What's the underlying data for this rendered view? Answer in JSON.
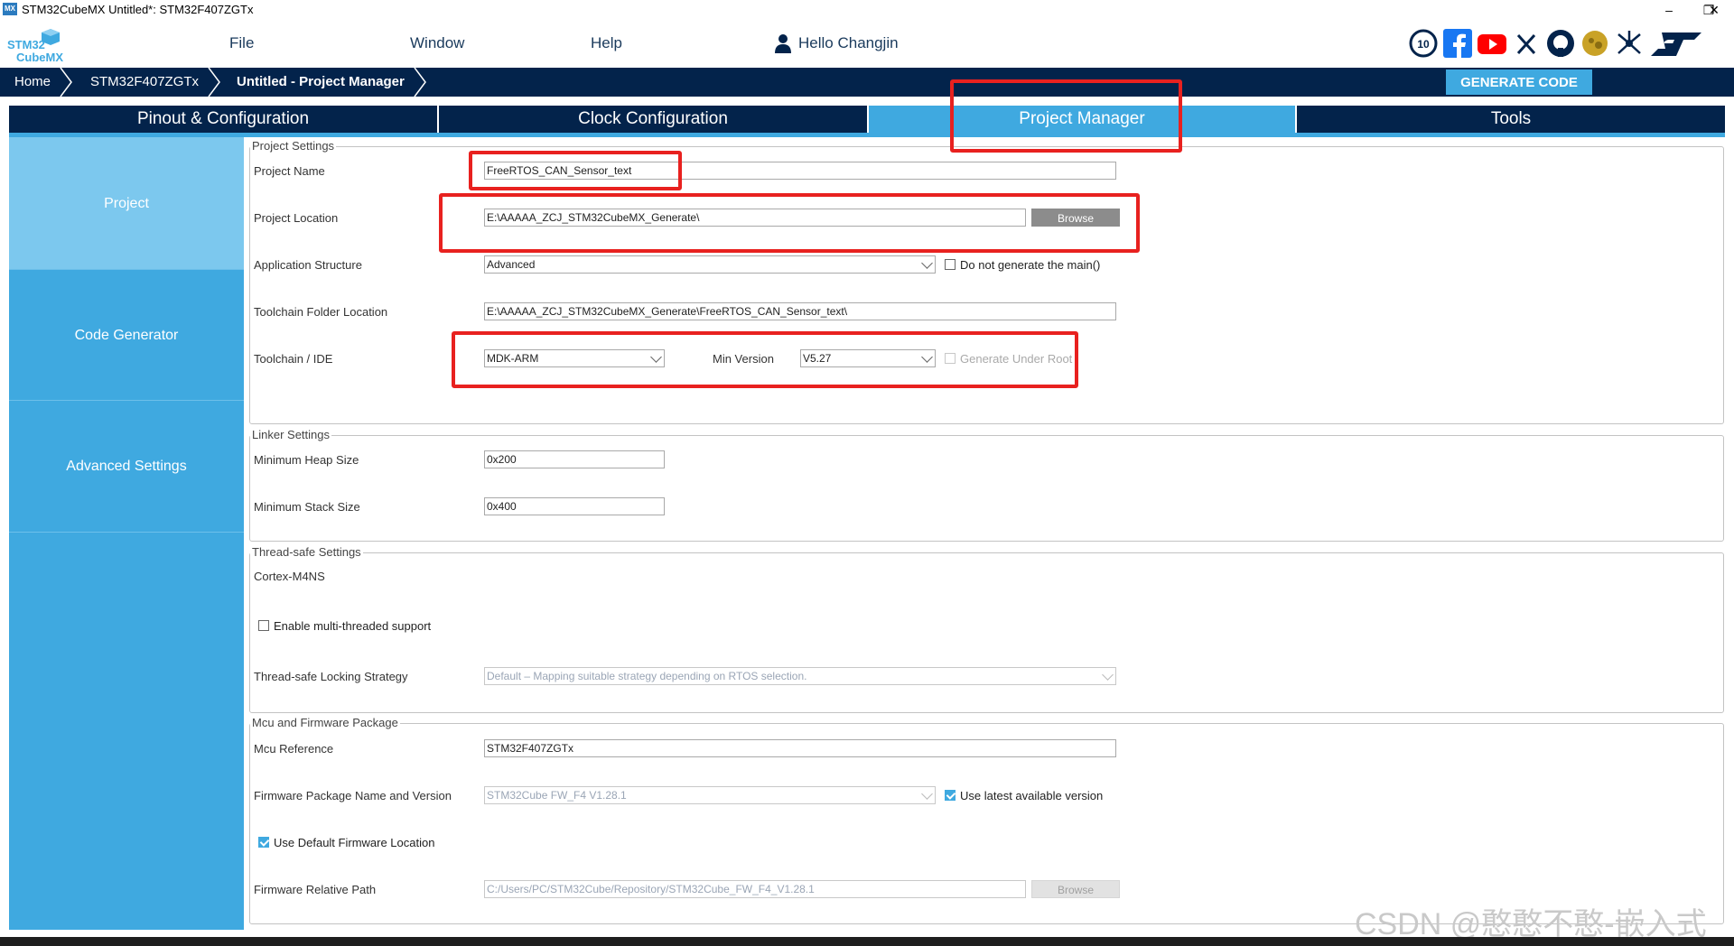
{
  "window": {
    "app_icon_text": "MX",
    "title": "STM32CubeMX Untitled*: STM32F407ZGTx",
    "controls": [
      "–",
      "❐",
      "✕"
    ]
  },
  "logo": {
    "line1": "STM32",
    "line2": "CubeMX"
  },
  "menu": {
    "items": [
      "File",
      "Window",
      "Help"
    ],
    "user_greeting": "Hello Changjin"
  },
  "social_icons": [
    "anniversary-icon",
    "facebook-icon",
    "youtube-icon",
    "x-icon",
    "github-icon",
    "community-icon",
    "network-icon",
    "st-logo-icon"
  ],
  "breadcrumb": [
    "Home",
    "STM32F407ZGTx",
    "Untitled - Project Manager"
  ],
  "generate_button": "GENERATE CODE",
  "tabs": [
    {
      "label": "Pinout & Configuration",
      "active": false
    },
    {
      "label": "Clock Configuration",
      "active": false
    },
    {
      "label": "Project Manager",
      "active": true
    },
    {
      "label": "Tools",
      "active": false
    }
  ],
  "sidebar": [
    {
      "label": "Project",
      "active": true
    },
    {
      "label": "Code Generator",
      "active": false
    },
    {
      "label": "Advanced Settings",
      "active": false
    }
  ],
  "project_settings": {
    "title": "Project Settings",
    "project_name_label": "Project Name",
    "project_name": "FreeRTOS_CAN_Sensor_text",
    "project_location_label": "Project Location",
    "project_location": "E:\\AAAAA_ZCJ_STM32CubeMX_Generate\\",
    "browse": "Browse",
    "app_structure_label": "Application Structure",
    "app_structure": "Advanced",
    "no_main_label": "Do not generate the main()",
    "no_main_checked": false,
    "toolchain_folder_label": "Toolchain Folder Location",
    "toolchain_folder": "E:\\AAAAA_ZCJ_STM32CubeMX_Generate\\FreeRTOS_CAN_Sensor_text\\",
    "toolchain_ide_label": "Toolchain / IDE",
    "toolchain_ide": "MDK-ARM",
    "min_version_label": "Min Version",
    "min_version": "V5.27",
    "gen_under_root_label": "Generate Under Root",
    "gen_under_root_checked": false
  },
  "linker_settings": {
    "title": "Linker Settings",
    "heap_label": "Minimum Heap Size",
    "heap": "0x200",
    "stack_label": "Minimum Stack Size",
    "stack": "0x400"
  },
  "thread_safe": {
    "title": "Thread-safe Settings",
    "core": "Cortex-M4NS",
    "enable_mt_label": "Enable multi-threaded support",
    "enable_mt_checked": false,
    "locking_label": "Thread-safe Locking Strategy",
    "locking": "Default  –  Mapping suitable strategy depending on RTOS selection."
  },
  "mcu_firmware": {
    "title": "Mcu and Firmware Package",
    "mcu_ref_label": "Mcu Reference",
    "mcu_ref": "STM32F407ZGTx",
    "fw_pkg_label": "Firmware Package Name and Version",
    "fw_pkg": "STM32Cube FW_F4 V1.28.1",
    "use_latest_label": "Use latest available version",
    "use_latest_checked": true,
    "use_default_loc_label": "Use Default Firmware Location",
    "use_default_loc_checked": true,
    "fw_rel_path_label": "Firmware Relative Path",
    "fw_rel_path": "C:/Users/PC/STM32Cube/Repository/STM32Cube_FW_F4_V1.28.1",
    "browse": "Browse"
  },
  "watermark": "CSDN @憨憨不憨-嵌入式",
  "colors": {
    "navy": "#03234b",
    "accent": "#3fa9e0",
    "highlight": "#e8211f"
  }
}
